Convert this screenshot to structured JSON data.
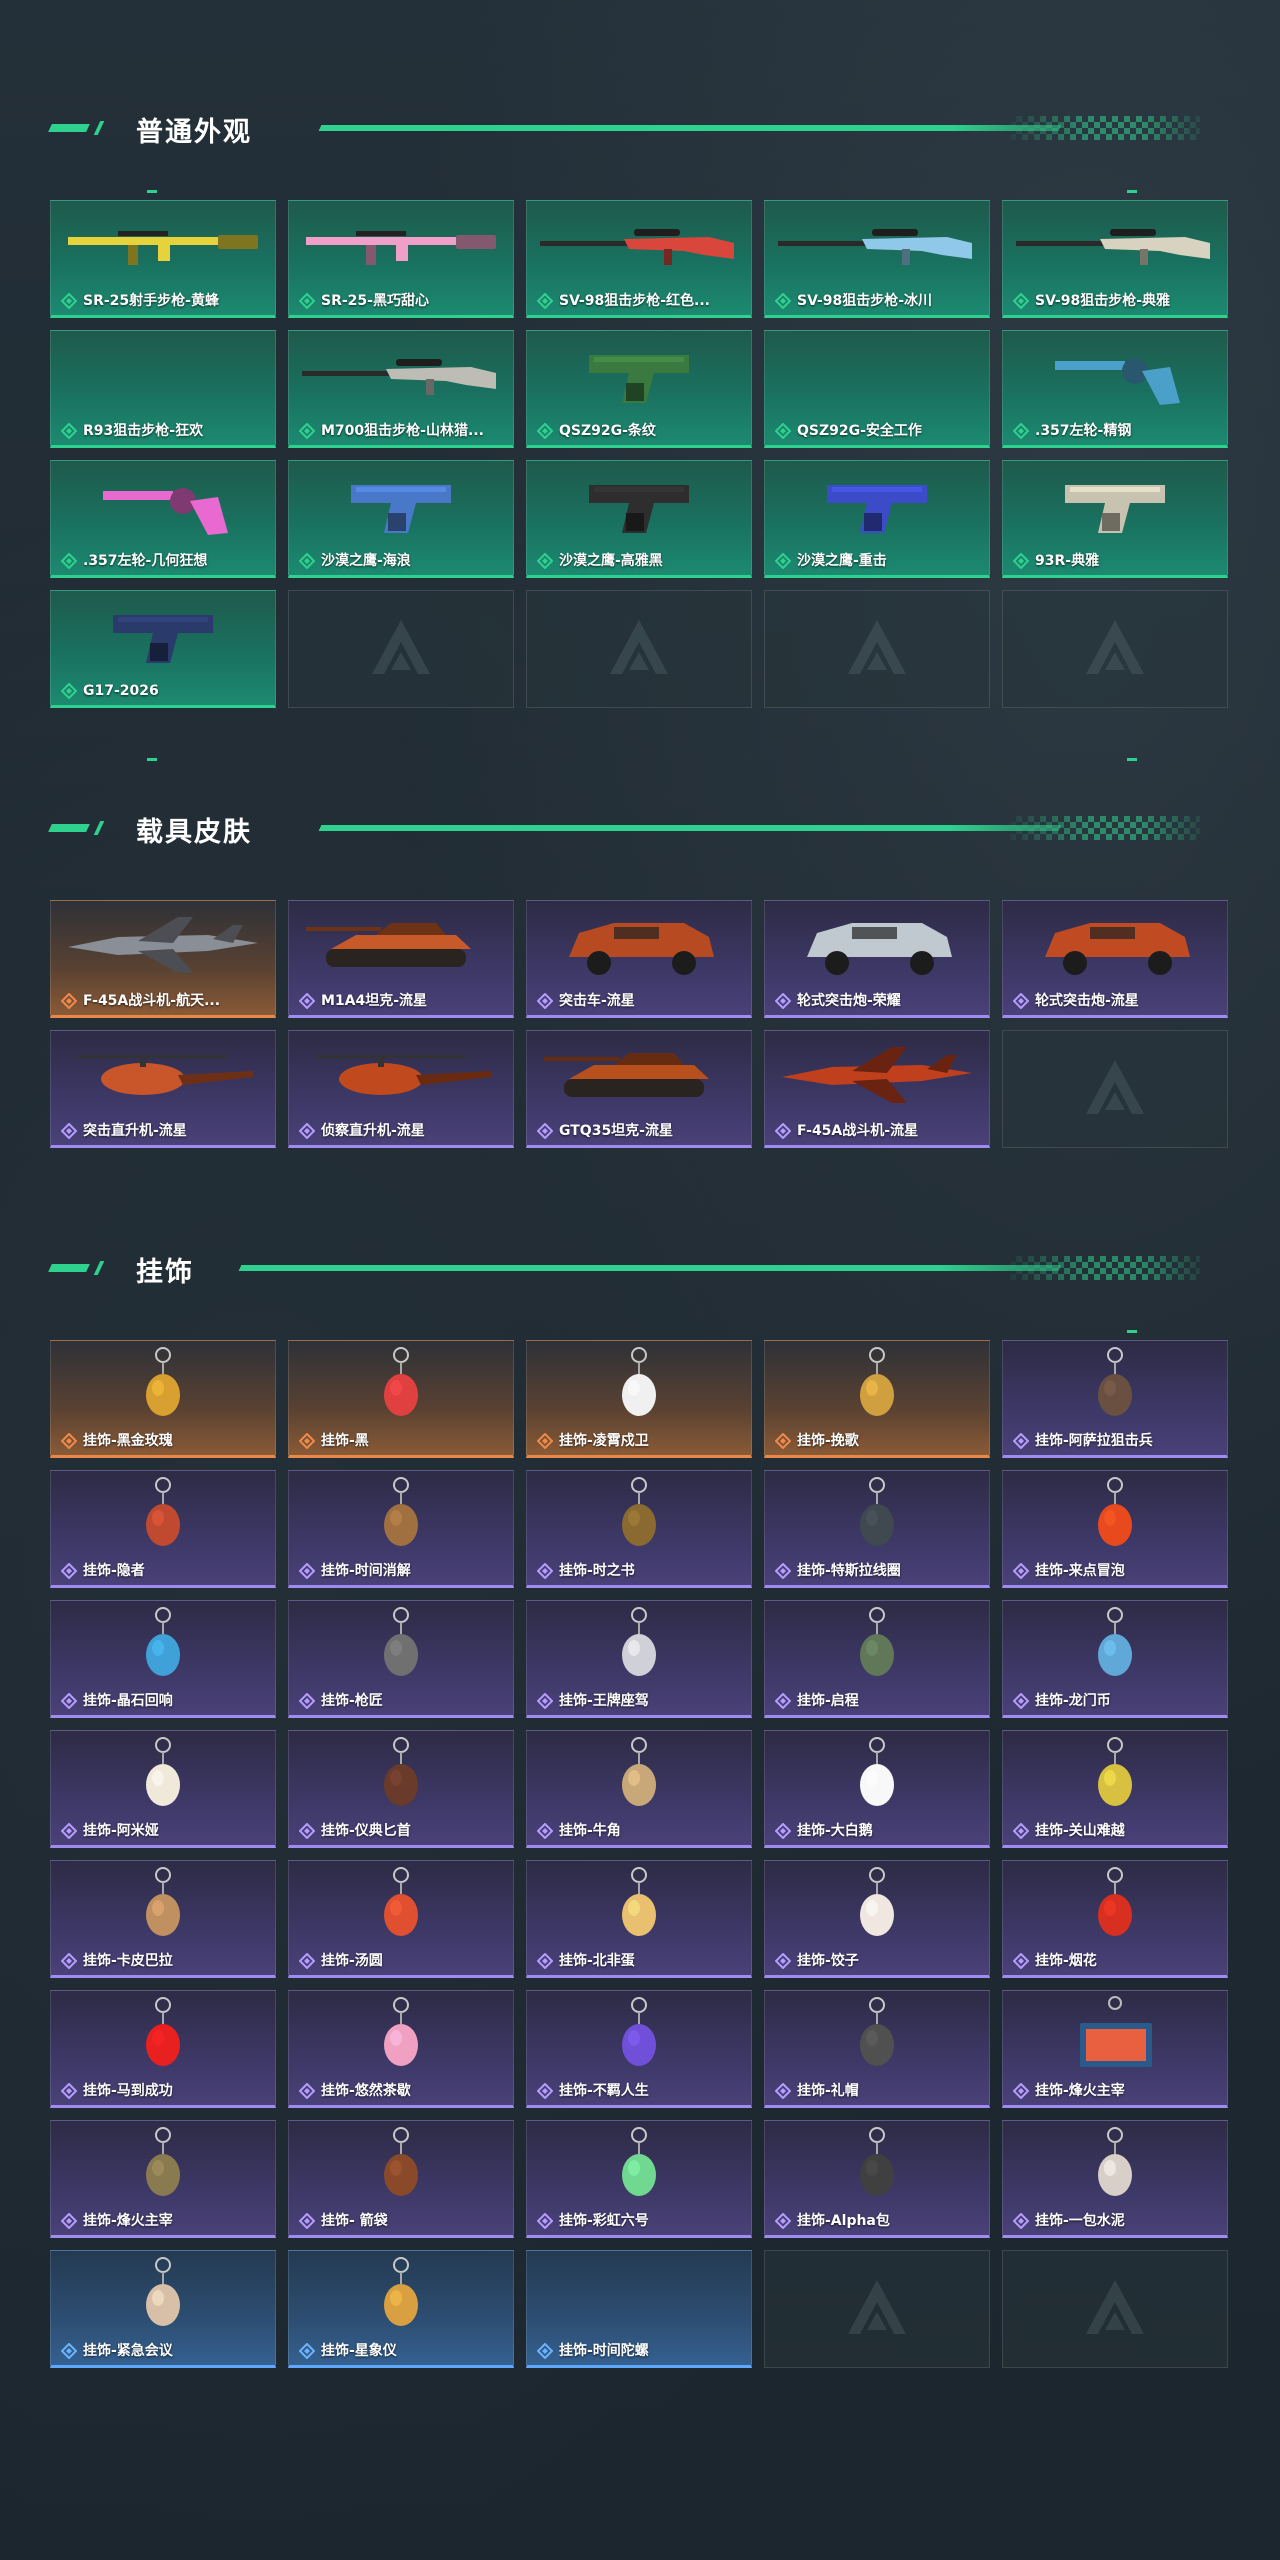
{
  "sections": [
    {
      "title": "普通外观",
      "items": [
        {
          "label": "SR-25射手步枪-黄蜂",
          "rarity": "green",
          "icon": "rifle-yellow-icon",
          "kind": "rifle",
          "color": "#e6d23a"
        },
        {
          "label": "SR-25-黑巧甜心",
          "rarity": "green",
          "icon": "rifle-pink-icon",
          "kind": "rifle",
          "color": "#f0a0c8"
        },
        {
          "label": "SV-98狙击步枪-红色...",
          "rarity": "green",
          "icon": "sniper-red-icon",
          "kind": "sniper",
          "color": "#d8463c"
        },
        {
          "label": "SV-98狙击步枪-冰川",
          "rarity": "green",
          "icon": "sniper-ice-icon",
          "kind": "sniper",
          "color": "#8fc8e8"
        },
        {
          "label": "SV-98狙击步枪-典雅",
          "rarity": "green",
          "icon": "sniper-elegant-icon",
          "kind": "sniper",
          "color": "#d8d2c0"
        },
        {
          "label": "R93狙击步枪-狂欢",
          "rarity": "green",
          "icon": "empty",
          "kind": "none",
          "color": ""
        },
        {
          "label": "M700狙击步枪-山林猎...",
          "rarity": "green",
          "icon": "sniper-forest-icon",
          "kind": "sniper",
          "color": "#bdbdb6"
        },
        {
          "label": "QSZ92G-条纹",
          "rarity": "green",
          "icon": "pistol-green-icon",
          "kind": "pistol",
          "color": "#3a7a40"
        },
        {
          "label": "QSZ92G-安全工作",
          "rarity": "green",
          "icon": "empty",
          "kind": "none",
          "color": ""
        },
        {
          "label": ".357左轮-精钢",
          "rarity": "green",
          "icon": "revolver-steel-icon",
          "kind": "revolver",
          "color": "#4aa0c8"
        },
        {
          "label": ".357左轮-几何狂想",
          "rarity": "green",
          "icon": "revolver-pink-icon",
          "kind": "revolver",
          "color": "#e86ad0"
        },
        {
          "label": "沙漠之鹰-海浪",
          "rarity": "green",
          "icon": "pistol-wave-icon",
          "kind": "pistol",
          "color": "#4a78c8"
        },
        {
          "label": "沙漠之鹰-高雅黑",
          "rarity": "green",
          "icon": "pistol-black-icon",
          "kind": "pistol",
          "color": "#2e2e2e"
        },
        {
          "label": "沙漠之鹰-重击",
          "rarity": "green",
          "icon": "pistol-strike-icon",
          "kind": "pistol",
          "color": "#3c4cc8"
        },
        {
          "label": "93R-典雅",
          "rarity": "green",
          "icon": "pistol-elegant-icon",
          "kind": "pistol",
          "color": "#c8c2b0"
        },
        {
          "label": "G17-2026",
          "rarity": "green",
          "icon": "pistol-navy-icon",
          "kind": "pistol",
          "color": "#2a3a6a"
        },
        {
          "label": "",
          "rarity": "empty"
        },
        {
          "label": "",
          "rarity": "empty"
        },
        {
          "label": "",
          "rarity": "empty"
        },
        {
          "label": "",
          "rarity": "empty"
        }
      ]
    },
    {
      "title": "载具皮肤",
      "items": [
        {
          "label": "F-45A战斗机-航天...",
          "rarity": "orange",
          "icon": "jet-icon",
          "kind": "jet",
          "color": "#8a8e96"
        },
        {
          "label": "M1A4坦克-流星",
          "rarity": "purple",
          "icon": "tank-icon",
          "kind": "tank",
          "color": "#c85a2a"
        },
        {
          "label": "突击车-流星",
          "rarity": "purple",
          "icon": "assault-vehicle-icon",
          "kind": "car",
          "color": "#b84a22"
        },
        {
          "label": "轮式突击炮-荣耀",
          "rarity": "purple",
          "icon": "wheeled-gun-icon",
          "kind": "car",
          "color": "#c0c8d0"
        },
        {
          "label": "轮式突击炮-流星",
          "rarity": "purple",
          "icon": "wheeled-gun-meteor-icon",
          "kind": "car",
          "color": "#c04a22"
        },
        {
          "label": "突击直升机-流星",
          "rarity": "purple",
          "icon": "attack-helicopter-icon",
          "kind": "heli",
          "color": "#c8562a"
        },
        {
          "label": "侦察直升机-流星",
          "rarity": "purple",
          "icon": "scout-helicopter-icon",
          "kind": "heli",
          "color": "#c04a1e"
        },
        {
          "label": "GTQ35坦克-流星",
          "rarity": "purple",
          "icon": "tank-gtq35-icon",
          "kind": "tank",
          "color": "#b8501e"
        },
        {
          "label": "F-45A战斗机-流星",
          "rarity": "purple",
          "icon": "jet-meteor-icon",
          "kind": "jet",
          "color": "#c0401e"
        },
        {
          "label": "",
          "rarity": "empty"
        }
      ]
    },
    {
      "title": "挂饰",
      "items": [
        {
          "label": "挂饰-黑金玫瑰",
          "rarity": "orange",
          "icon": "charm-black-gold-rose-icon",
          "kind": "charm",
          "color": "#d8a030"
        },
        {
          "label": "挂饰-黑",
          "rarity": "orange",
          "icon": "charm-black-icon",
          "kind": "charm",
          "color": "#e04040"
        },
        {
          "label": "挂饰-凌霄戍卫",
          "rarity": "orange",
          "icon": "charm-guardian-icon",
          "kind": "charm",
          "color": "#f0f0f0"
        },
        {
          "label": "挂饰-挽歌",
          "rarity": "orange",
          "icon": "charm-elegy-icon",
          "kind": "charm",
          "color": "#d0a040"
        },
        {
          "label": "挂饰-阿萨拉狙击兵",
          "rarity": "purple",
          "icon": "charm-sniper-icon",
          "kind": "charm",
          "color": "#6a5040"
        },
        {
          "label": "挂饰-隐者",
          "rarity": "purple",
          "icon": "charm-hermit-icon",
          "kind": "charm",
          "color": "#c04a30"
        },
        {
          "label": "挂饰-时间消解",
          "rarity": "purple",
          "icon": "charm-time-dissolve-icon",
          "kind": "charm",
          "color": "#a07040"
        },
        {
          "label": "挂饰-时之书",
          "rarity": "purple",
          "icon": "charm-book-icon",
          "kind": "charm",
          "color": "#8a6a30"
        },
        {
          "label": "挂饰-特斯拉线圈",
          "rarity": "purple",
          "icon": "charm-tesla-icon",
          "kind": "charm",
          "color": "#404850"
        },
        {
          "label": "挂饰-来点冒泡",
          "rarity": "purple",
          "icon": "charm-bubble-icon",
          "kind": "charm",
          "color": "#e84a1e"
        },
        {
          "label": "挂饰-晶石回响",
          "rarity": "purple",
          "icon": "charm-crystal-icon",
          "kind": "charm",
          "color": "#40a0d8"
        },
        {
          "label": "挂饰-枪匠",
          "rarity": "purple",
          "icon": "charm-gunsmith-icon",
          "kind": "charm",
          "color": "#707070"
        },
        {
          "label": "挂饰-王牌座驾",
          "rarity": "purple",
          "icon": "charm-plane-icon",
          "kind": "charm",
          "color": "#d0d0d8"
        },
        {
          "label": "挂饰-启程",
          "rarity": "purple",
          "icon": "charm-departure-icon",
          "kind": "charm",
          "color": "#607858"
        },
        {
          "label": "挂饰-龙门币",
          "rarity": "purple",
          "icon": "charm-coin-icon",
          "kind": "charm",
          "color": "#60a8d8"
        },
        {
          "label": "挂饰-阿米娅",
          "rarity": "purple",
          "icon": "charm-amiya-icon",
          "kind": "charm",
          "color": "#f0e8d8"
        },
        {
          "label": "挂饰-仪典匕首",
          "rarity": "purple",
          "icon": "charm-dagger-icon",
          "kind": "charm",
          "color": "#6a3a2a"
        },
        {
          "label": "挂饰-牛角",
          "rarity": "purple",
          "icon": "charm-horn-icon",
          "kind": "charm",
          "color": "#c8a878"
        },
        {
          "label": "挂饰-大白鹅",
          "rarity": "purple",
          "icon": "charm-goose-icon",
          "kind": "charm",
          "color": "#f8f8f8"
        },
        {
          "label": "挂饰-关山难越",
          "rarity": "purple",
          "icon": "charm-bottle-icon",
          "kind": "charm",
          "color": "#d8c040"
        },
        {
          "label": "挂饰-卡皮巴拉",
          "rarity": "purple",
          "icon": "charm-capybara-icon",
          "kind": "charm",
          "color": "#c09060"
        },
        {
          "label": "挂饰-汤圆",
          "rarity": "purple",
          "icon": "charm-tangyuan-icon",
          "kind": "charm",
          "color": "#e05030"
        },
        {
          "label": "挂饰-北非蛋",
          "rarity": "purple",
          "icon": "charm-shakshuka-icon",
          "kind": "charm",
          "color": "#e8c070"
        },
        {
          "label": "挂饰-饺子",
          "rarity": "purple",
          "icon": "charm-dumpling-icon",
          "kind": "charm",
          "color": "#f0e8e0"
        },
        {
          "label": "挂饰-烟花",
          "rarity": "purple",
          "icon": "charm-firework-icon",
          "kind": "charm",
          "color": "#d83020"
        },
        {
          "label": "挂饰-马到成功",
          "rarity": "purple",
          "icon": "charm-horse-icon",
          "kind": "charm",
          "color": "#e82020"
        },
        {
          "label": "挂饰-悠然茶歇",
          "rarity": "purple",
          "icon": "charm-cupcake-icon",
          "kind": "charm",
          "color": "#f0a0c0"
        },
        {
          "label": "挂饰-不羁人生",
          "rarity": "purple",
          "icon": "charm-sneaker-icon",
          "kind": "charm",
          "color": "#7050d8"
        },
        {
          "label": "挂饰-礼帽",
          "rarity": "purple",
          "icon": "charm-hat-icon",
          "kind": "charm",
          "color": "#505050"
        },
        {
          "label": "挂饰-烽火主宰",
          "rarity": "purple",
          "icon": "charm-banner-icon",
          "kind": "banner",
          "color": "#e86040"
        },
        {
          "label": "挂饰-烽火主宰",
          "rarity": "purple",
          "icon": "charm-pyramid-icon",
          "kind": "charm",
          "color": "#8a7a50"
        },
        {
          "label": "挂饰- 箭袋",
          "rarity": "purple",
          "icon": "charm-quiver-icon",
          "kind": "charm",
          "color": "#8a4a2a"
        },
        {
          "label": "挂饰-彩虹六号",
          "rarity": "purple",
          "icon": "charm-r6-icon",
          "kind": "charm",
          "color": "#70d890"
        },
        {
          "label": "挂饰-Alpha包",
          "rarity": "purple",
          "icon": "charm-alpha-bag-icon",
          "kind": "charm",
          "color": "#404040"
        },
        {
          "label": "挂饰-一包水泥",
          "rarity": "purple",
          "icon": "charm-cement-icon",
          "kind": "charm",
          "color": "#d8d0c8"
        },
        {
          "label": "挂饰-紧急会议",
          "rarity": "blue",
          "icon": "charm-meeting-icon",
          "kind": "charm",
          "color": "#d8c0a8"
        },
        {
          "label": "挂饰-星象仪",
          "rarity": "blue",
          "icon": "charm-astrolabe-icon",
          "kind": "charm",
          "color": "#d8a040"
        },
        {
          "label": "挂饰-时间陀螺",
          "rarity": "blue",
          "icon": "empty",
          "kind": "none",
          "color": ""
        },
        {
          "label": "",
          "rarity": "empty"
        },
        {
          "label": "",
          "rarity": "empty"
        }
      ]
    }
  ]
}
